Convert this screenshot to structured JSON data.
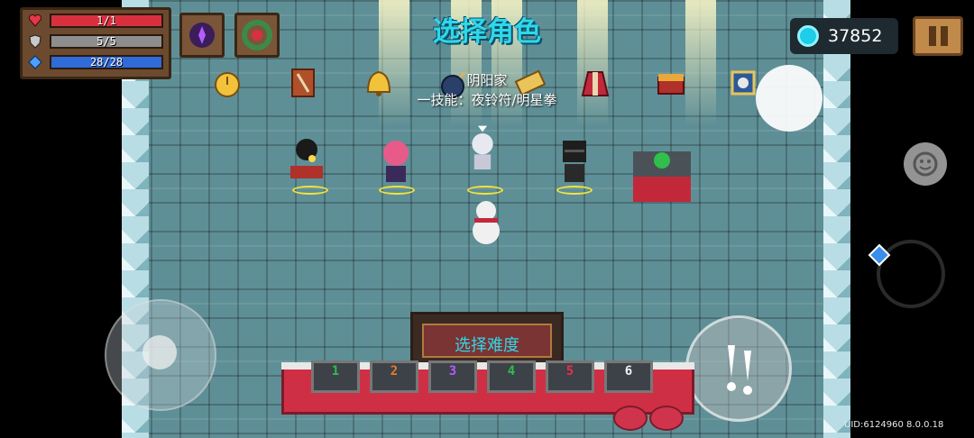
{
  "hud": {
    "hp": "1/1",
    "armor": "5/5",
    "energy": "28/28",
    "hp_fill": 1.0,
    "armor_fill": 1.0,
    "energy_fill": 1.0
  },
  "header": {
    "title": "选择角色"
  },
  "currency": {
    "gems": "37852"
  },
  "character": {
    "name": "阴阳家",
    "skill": "一技能：夜铃符/明星拳"
  },
  "difficulty": {
    "title": "选择难度",
    "slots": [
      "1",
      "2",
      "3",
      "4",
      "5",
      "6"
    ]
  },
  "footer": {
    "uid": "UID:6124960 8.0.0.18"
  },
  "colors": {
    "hp": "#d9303f",
    "armor": "#8e8e8e",
    "energy": "#2f6bd9",
    "title": "#2fd7e8"
  },
  "icons": [
    "heart-icon",
    "shield-icon",
    "diamond-icon",
    "gem-icon",
    "pause-icon",
    "emote-icon",
    "swap-weapon-icon",
    "attack-icon"
  ]
}
